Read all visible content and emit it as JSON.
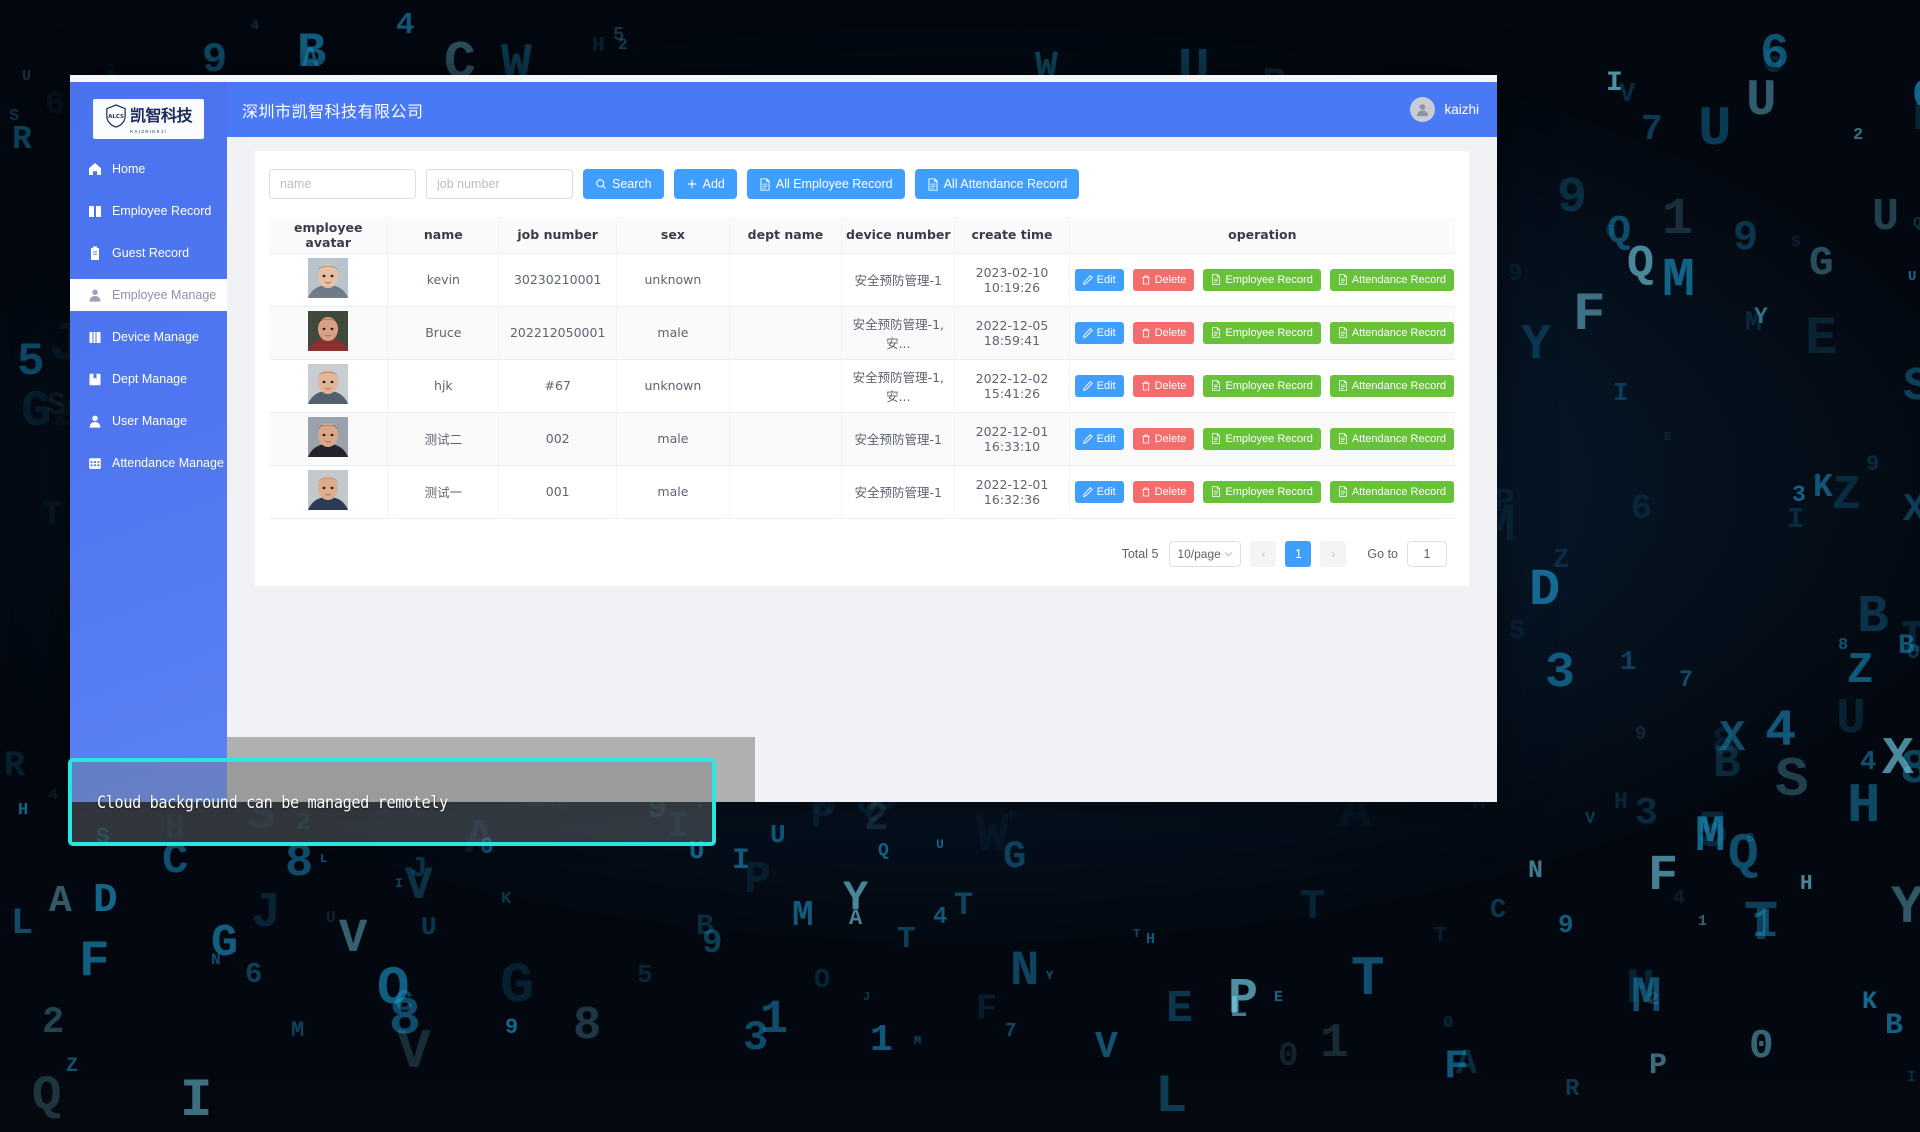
{
  "background": {
    "style": "matrix-code-rain",
    "glyph_color": "#1d9fd6",
    "glyphs": "ABCDEFGHIJKLMNOPQRSTUVWXYZ0123456789"
  },
  "sidebar": {
    "logo": {
      "cn_text": "凯智科技",
      "sub_text": "KAIZHIKEJI",
      "icon": "shield-logo-icon"
    },
    "items": [
      {
        "label": "Home",
        "icon": "home-icon",
        "active": false,
        "name": "sidebar-item-home"
      },
      {
        "label": "Employee Record",
        "icon": "book-icon",
        "active": false,
        "name": "sidebar-item-employee-record"
      },
      {
        "label": "Guest Record",
        "icon": "clipboard-icon",
        "active": false,
        "name": "sidebar-item-guest-record"
      },
      {
        "label": "Employee Manage",
        "icon": "user-icon",
        "active": true,
        "name": "sidebar-item-employee-manage"
      },
      {
        "label": "Device Manage",
        "icon": "device-icon",
        "active": false,
        "name": "sidebar-item-device-manage"
      },
      {
        "label": "Dept Manage",
        "icon": "notebook-icon",
        "active": false,
        "name": "sidebar-item-dept-manage"
      },
      {
        "label": "User Manage",
        "icon": "person-icon",
        "active": false,
        "name": "sidebar-item-user-manage"
      },
      {
        "label": "Attendance Manage",
        "icon": "calendar-icon",
        "active": false,
        "name": "sidebar-item-attendance-manage"
      }
    ]
  },
  "header": {
    "title": "深圳市凯智科技有限公司",
    "user_name": "kaizhi",
    "avatar_icon": "user-avatar-icon",
    "bg_color": "#4a79f5"
  },
  "toolbar": {
    "name_placeholder": "name",
    "name_value": "",
    "job_number_placeholder": "job number",
    "job_number_value": "",
    "search_label": "Search",
    "add_label": "Add",
    "all_employee_record_label": "All Employee Record",
    "all_attendance_record_label": "All Attendance Record"
  },
  "table": {
    "columns": [
      "employee avatar",
      "name",
      "job number",
      "sex",
      "dept name",
      "device number",
      "create time",
      "operation"
    ],
    "row_actions": {
      "edit": "Edit",
      "delete": "Delete",
      "employee_record": "Employee Record",
      "attendance_record": "Attendance Record"
    },
    "rows": [
      {
        "avatar": "photo-kevin",
        "name": "kevin",
        "job_number": "30230210001",
        "sex": "unknown",
        "dept_name": "",
        "device_number": "安全预防管理-1",
        "create_time": "2023-02-10 10:19:26"
      },
      {
        "avatar": "photo-bruce",
        "name": "Bruce",
        "job_number": "202212050001",
        "sex": "male",
        "dept_name": "",
        "device_number": "安全预防管理-1,安...",
        "create_time": "2022-12-05 18:59:41"
      },
      {
        "avatar": "photo-hjk",
        "name": "hjk",
        "job_number": "#67",
        "sex": "unknown",
        "dept_name": "",
        "device_number": "安全预防管理-1,安...",
        "create_time": "2022-12-02 15:41:26"
      },
      {
        "avatar": "photo-ceshi-er",
        "name": "测试二",
        "job_number": "002",
        "sex": "male",
        "dept_name": "",
        "device_number": "安全预防管理-1",
        "create_time": "2022-12-01 16:33:10"
      },
      {
        "avatar": "photo-ceshi-yi",
        "name": "测试一",
        "job_number": "001",
        "sex": "male",
        "dept_name": "",
        "device_number": "安全预防管理-1",
        "create_time": "2022-12-01 16:32:36"
      }
    ]
  },
  "pagination": {
    "total_label": "Total 5",
    "page_size_label": "10/page",
    "prev_arrow": "‹",
    "next_arrow": "›",
    "current_page": "1",
    "goto_label": "Go to",
    "goto_value": "1"
  },
  "caption": {
    "text": "Cloud background can be managed remotely",
    "border_color": "#29e6e0"
  },
  "colors": {
    "primary_blue": "#409eff",
    "header_blue": "#4a79f5",
    "danger_red": "#f56c6c",
    "success_green": "#67c23a",
    "sidebar_blue": "#4f76f0"
  }
}
